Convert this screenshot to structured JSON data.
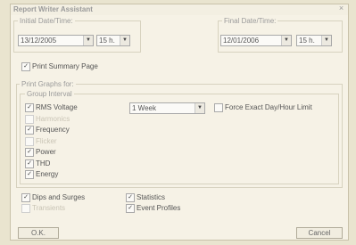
{
  "window": {
    "title": "Report Writer Assistant",
    "close_glyph": "×"
  },
  "initial": {
    "legend": "Initial Date/Time:",
    "date": "13/12/2005",
    "hour": "15 h."
  },
  "final": {
    "legend": "Final Date/Time:",
    "date": "12/01/2006",
    "hour": "15 h."
  },
  "print_summary": {
    "label": "Print Summary Page",
    "checked": true
  },
  "graphs": {
    "legend": "Print Graphs for:",
    "group_interval_legend": "Group Interval",
    "interval_value": "1 Week",
    "force_exact": {
      "label": "Force Exact Day/Hour Limit",
      "checked": false
    },
    "items": [
      {
        "label": "RMS Voltage",
        "checked": true,
        "enabled": true
      },
      {
        "label": "Harmonics",
        "checked": false,
        "enabled": false
      },
      {
        "label": "Frequency",
        "checked": true,
        "enabled": true
      },
      {
        "label": "Flicker",
        "checked": false,
        "enabled": false
      },
      {
        "label": "Power",
        "checked": true,
        "enabled": true
      },
      {
        "label": "THD",
        "checked": true,
        "enabled": true
      },
      {
        "label": "Energy",
        "checked": true,
        "enabled": true
      }
    ]
  },
  "bottom_checks": {
    "dips": {
      "label": "Dips and Surges",
      "checked": true,
      "enabled": true
    },
    "transients": {
      "label": "Transients",
      "checked": false,
      "enabled": false
    },
    "statistics": {
      "label": "Statistics",
      "checked": true,
      "enabled": true
    },
    "event_profiles": {
      "label": "Event Profiles",
      "checked": true,
      "enabled": true
    }
  },
  "buttons": {
    "ok": "O.K.",
    "cancel": "Cancel"
  },
  "icons": {
    "dropdown": "▼",
    "check": "✓"
  }
}
